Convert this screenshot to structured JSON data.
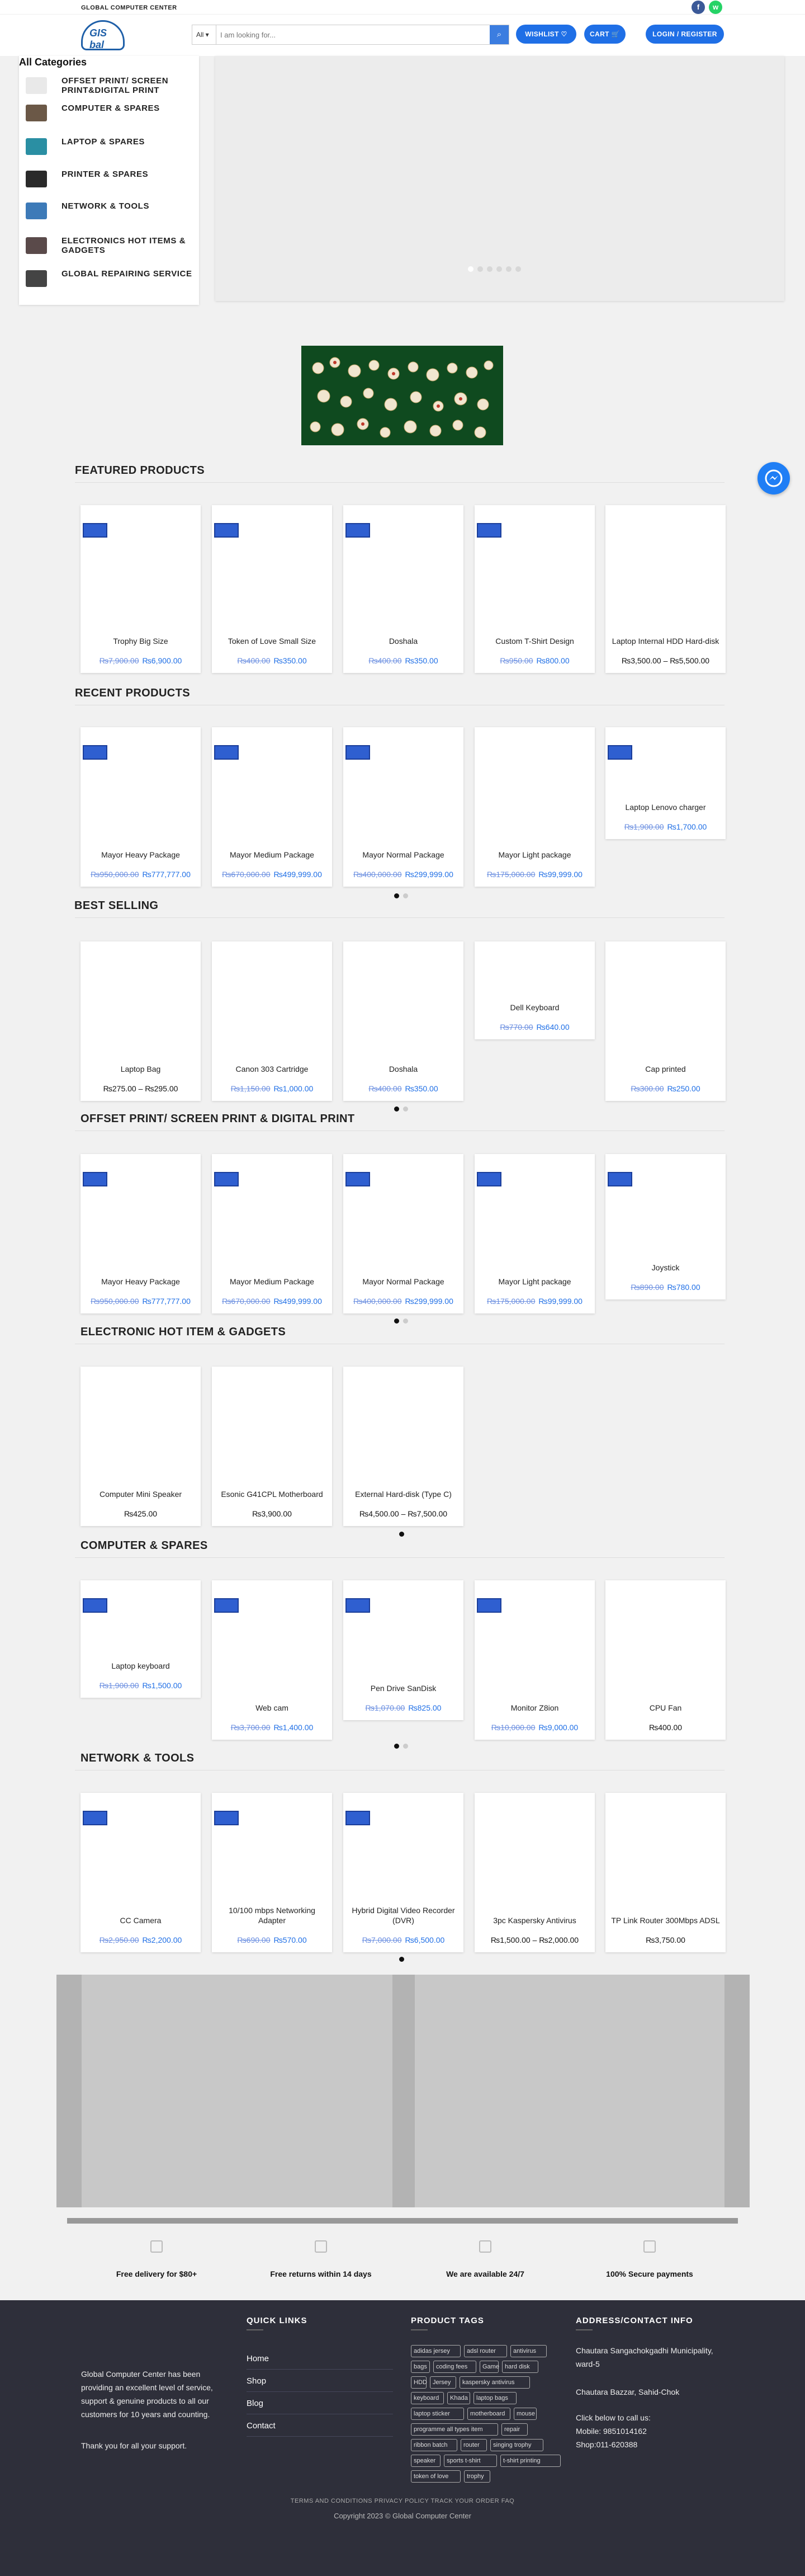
{
  "topbar": {
    "brand": "GLOBAL COMPUTER CENTER",
    "social": [
      {
        "icon": "facebook-icon",
        "label": "f",
        "color": "#3b5998"
      },
      {
        "icon": "whatsapp-icon",
        "label": "w",
        "color": "#25d366"
      }
    ]
  },
  "header": {
    "logo_text": "GIS bal",
    "category_select": "All",
    "search_placeholder": "I am looking for...",
    "wishlist": "WISHLIST",
    "cart": "CART",
    "login": "LOGIN / REGISTER"
  },
  "sidebar": {
    "title": "All Categories",
    "items": [
      {
        "label": "OFFSET PRINT/ SCREEN PRINT&DIGITAL PRINT",
        "color": "#e9e9e9"
      },
      {
        "label": "COMPUTER & SPARES",
        "color": "#6b5847"
      },
      {
        "label": "LAPTOP & SPARES",
        "color": "#2a8fa3"
      },
      {
        "label": "PRINTER & SPARES",
        "color": "#2a2a2a"
      },
      {
        "label": "NETWORK & TOOLS",
        "color": "#3d7ab8"
      },
      {
        "label": "ELECTRONICS HOT ITEMS & GADGETS",
        "color": "#5a4a4a"
      },
      {
        "label": "GLOBAL REPAIRING SERVICE",
        "color": "#444"
      }
    ]
  },
  "sections": {
    "featured": "FEATURED PRODUCTS",
    "recent": "RECENT PRODUCTS",
    "best": "BEST SELLING",
    "offset": "OFFSET PRINT/ SCREEN PRINT & DIGITAL PRINT",
    "electronic": "ELECTRONIC HOT ITEM & GADGETS",
    "computer": "COMPUTER & SPARES",
    "network": "NETWORK & TOOLS"
  },
  "featured": [
    {
      "name": "Trophy Big Size",
      "old": "₨7,900.00",
      "new": "₨6,900.00"
    },
    {
      "name": "Token of Love Small Size",
      "old": "₨400.00",
      "new": "₨350.00"
    },
    {
      "name": "Doshala",
      "old": "₨400.00",
      "new": "₨350.00"
    },
    {
      "name": "Custom T-Shirt Design",
      "old": "₨950.00",
      "new": "₨800.00"
    },
    {
      "name": "Laptop Internal HDD Hard-disk",
      "old": "",
      "new": "₨3,500.00 – ₨5,500.00"
    }
  ],
  "recent": [
    {
      "name": "Mayor Heavy Package",
      "old": "₨950,000.00",
      "new": "₨777,777.00"
    },
    {
      "name": "Mayor Medium Package",
      "old": "₨670,000.00",
      "new": "₨499,999.00"
    },
    {
      "name": "Mayor Normal Package",
      "old": "₨400,000.00",
      "new": "₨299,999.00"
    },
    {
      "name": "Mayor Light package",
      "old": "₨175,000.00",
      "new": "₨99,999.00"
    },
    {
      "name": "Laptop Lenovo charger",
      "old": "₨1,900.00",
      "new": "₨1,700.00"
    }
  ],
  "best": [
    {
      "name": "Laptop Bag",
      "old": "",
      "new": "₨275.00 – ₨295.00"
    },
    {
      "name": "Canon 303 Cartridge",
      "old": "₨1,150.00",
      "new": "₨1,000.00"
    },
    {
      "name": "Doshala",
      "old": "₨400.00",
      "new": "₨350.00"
    },
    {
      "name": "Dell Keyboard",
      "old": "₨770.00",
      "new": "₨640.00"
    },
    {
      "name": "Cap printed",
      "old": "₨300.00",
      "new": "₨250.00"
    }
  ],
  "offset": [
    {
      "name": "Mayor Heavy Package",
      "old": "₨950,000.00",
      "new": "₨777,777.00"
    },
    {
      "name": "Mayor Medium Package",
      "old": "₨670,000.00",
      "new": "₨499,999.00"
    },
    {
      "name": "Mayor Normal Package",
      "old": "₨400,000.00",
      "new": "₨299,999.00"
    },
    {
      "name": "Mayor Light package",
      "old": "₨175,000.00",
      "new": "₨99,999.00"
    },
    {
      "name": "Joystick",
      "old": "₨890.00",
      "new": "₨780.00"
    }
  ],
  "electronic": [
    {
      "name": "Computer Mini Speaker",
      "old": "",
      "new": "₨425.00"
    },
    {
      "name": "Esonic G41CPL Motherboard",
      "old": "",
      "new": "₨3,900.00"
    },
    {
      "name": "External Hard-disk (Type C)",
      "old": "",
      "new": "₨4,500.00 – ₨7,500.00"
    }
  ],
  "computer": [
    {
      "name": "Laptop keyboard",
      "old": "₨1,900.00",
      "new": "₨1,500.00"
    },
    {
      "name": "Web cam",
      "old": "₨3,700.00",
      "new": "₨1,400.00"
    },
    {
      "name": "Pen Drive SanDisk",
      "old": "₨1,070.00",
      "new": "₨825.00"
    },
    {
      "name": "Monitor Z8ion",
      "old": "₨10,000.00",
      "new": "₨9,000.00"
    },
    {
      "name": "CPU Fan",
      "old": "",
      "new": "₨400.00"
    }
  ],
  "network": [
    {
      "name": "CC Camera",
      "old": "₨2,950.00",
      "new": "₨2,200.00"
    },
    {
      "name": "10/100 mbps Networking Adapter",
      "old": "₨690.00",
      "new": "₨570.00"
    },
    {
      "name": "Hybrid Digital Video Recorder (DVR)",
      "old": "₨7,000.00",
      "new": "₨6,500.00"
    },
    {
      "name": "3pc Kaspersky Antivirus",
      "old": "",
      "new": "₨1,500.00 – ₨2,000.00"
    },
    {
      "name": "TP Link Router 300Mbps ADSL",
      "old": "",
      "new": "₨3,750.00"
    }
  ],
  "features": [
    "Free delivery for $80+",
    "Free returns within 14 days",
    "We are available 24/7",
    "100% Secure payments"
  ],
  "footer": {
    "about": "Global Computer Center has been providing an excellent level of service, support & genuine products to all our customers for 10 years and counting.",
    "thanks": "Thank you for all your support.",
    "quick_title": "QUICK LINKS",
    "quick_links": [
      "Home",
      "Shop",
      "Blog",
      "Contact"
    ],
    "tags_title": "PRODUCT TAGS",
    "tags": [
      "adidas jersey",
      "adsl router",
      "antivirus",
      "bags",
      "coding fees",
      "Game",
      "hard disk",
      "HDD",
      "Jersey",
      "kaspersky antivirus",
      "keyboard",
      "Khada",
      "laptop bags",
      "laptop sticker",
      "motherboard",
      "mouse",
      "programme all types item",
      "repair",
      "ribbon batch",
      "router",
      "singing trophy",
      "speaker",
      "sports t-shirt",
      "t-shirt printing",
      "token of love",
      "trophy"
    ],
    "address_title": "ADDRESS/CONTACT INFO",
    "address1": "Chautara Sangachokgadhi Municipality, ward-5",
    "address2": "Chautara Bazzar, Sahid-Chok",
    "call": "Click below to call us:",
    "mobile": "Mobile: 9851014162",
    "shop": "Shop:011-620388",
    "bottom_links": "TERMS AND CONDITIONS   PRIVACY POLICY   TRACK YOUR ORDER   FAQ",
    "copyright": "Copyright 2023 © Global Computer Center"
  }
}
